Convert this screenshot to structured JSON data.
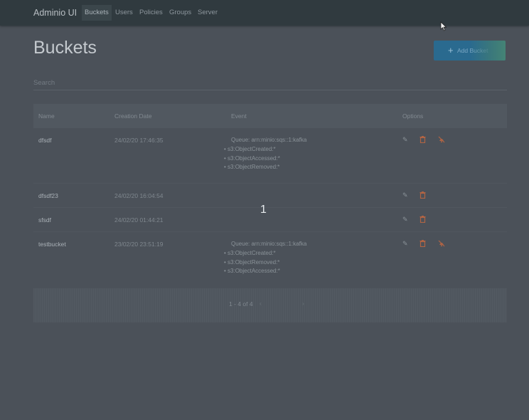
{
  "nav": {
    "brand": "Adminio UI",
    "items": [
      {
        "label": "Buckets",
        "active": true
      },
      {
        "label": "Users"
      },
      {
        "label": "Policies"
      },
      {
        "label": "Groups"
      },
      {
        "label": "Server"
      }
    ]
  },
  "page": {
    "title": "Buckets",
    "add_button": "Add Bucket",
    "add_icon": "+",
    "search_placeholder": "Search"
  },
  "table": {
    "headers": [
      "Name",
      "Creation Date",
      "Event",
      "Options"
    ],
    "rows": [
      {
        "name": "dfsdf",
        "date": "24/02/20 17:46:35",
        "queue": "Queue: arn:minio:sqs::1:kafka",
        "events": [
          "s3:ObjectCreated:*",
          "s3:ObjectAccessed:*",
          "s3:ObjectRemoved:*"
        ],
        "has_event_option": true
      },
      {
        "name": "dfsdf23",
        "date": "24/02/20 16:04:54",
        "queue": "",
        "events": [],
        "has_event_option": false
      },
      {
        "name": "sfsdf",
        "date": "24/02/20 01:44:21",
        "queue": "",
        "events": [],
        "has_event_option": false
      },
      {
        "name": "testbucket",
        "date": "23/02/20 23:51:19",
        "queue": "Queue: arn:minio:sqs::1:kafka",
        "events": [
          "s3:ObjectCreated:*",
          "s3:ObjectRemoved:*",
          "s3:ObjectAccessed:*"
        ],
        "has_event_option": true
      }
    ]
  },
  "pagination": {
    "text": "1 - 4 of 4",
    "prev": "‹",
    "next": "›"
  },
  "overlay_number": "1",
  "colors": {
    "delete": "#b06444",
    "primary": "#2a6a8f"
  },
  "icons": {
    "edit": "pencil-icon",
    "delete": "trash-icon",
    "event": "event-remove-icon"
  }
}
